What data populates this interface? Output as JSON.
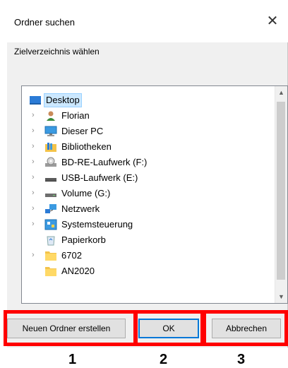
{
  "window": {
    "title": "Ordner suchen",
    "close_glyph": "✕"
  },
  "instruction": "Zielverzeichnis wählen",
  "tree": {
    "items": [
      {
        "label": "Desktop",
        "icon": "desktop-folder-icon",
        "expandable": false,
        "selected": true
      },
      {
        "label": "Florian",
        "icon": "user-icon",
        "expandable": true
      },
      {
        "label": "Dieser PC",
        "icon": "computer-icon",
        "expandable": true
      },
      {
        "label": "Bibliotheken",
        "icon": "libraries-icon",
        "expandable": true
      },
      {
        "label": "BD-RE-Laufwerk (F:)",
        "icon": "optical-drive-icon",
        "expandable": true
      },
      {
        "label": "USB-Laufwerk (E:)",
        "icon": "usb-drive-icon",
        "expandable": true
      },
      {
        "label": "Volume (G:)",
        "icon": "drive-icon",
        "expandable": true
      },
      {
        "label": "Netzwerk",
        "icon": "network-icon",
        "expandable": true
      },
      {
        "label": "Systemsteuerung",
        "icon": "control-panel-icon",
        "expandable": true
      },
      {
        "label": "Papierkorb",
        "icon": "recycle-bin-icon",
        "expandable": false
      },
      {
        "label": "6702",
        "icon": "folder-icon",
        "expandable": true
      },
      {
        "label": "AN2020",
        "icon": "folder-icon",
        "expandable": false
      }
    ]
  },
  "buttons": {
    "new_folder": "Neuen Ordner erstellen",
    "ok": "OK",
    "cancel": "Abbrechen"
  },
  "annotations": [
    "1",
    "2",
    "3"
  ],
  "colors": {
    "highlight": "#ff0000",
    "selection": "#cce8ff",
    "accent": "#0078d7"
  }
}
